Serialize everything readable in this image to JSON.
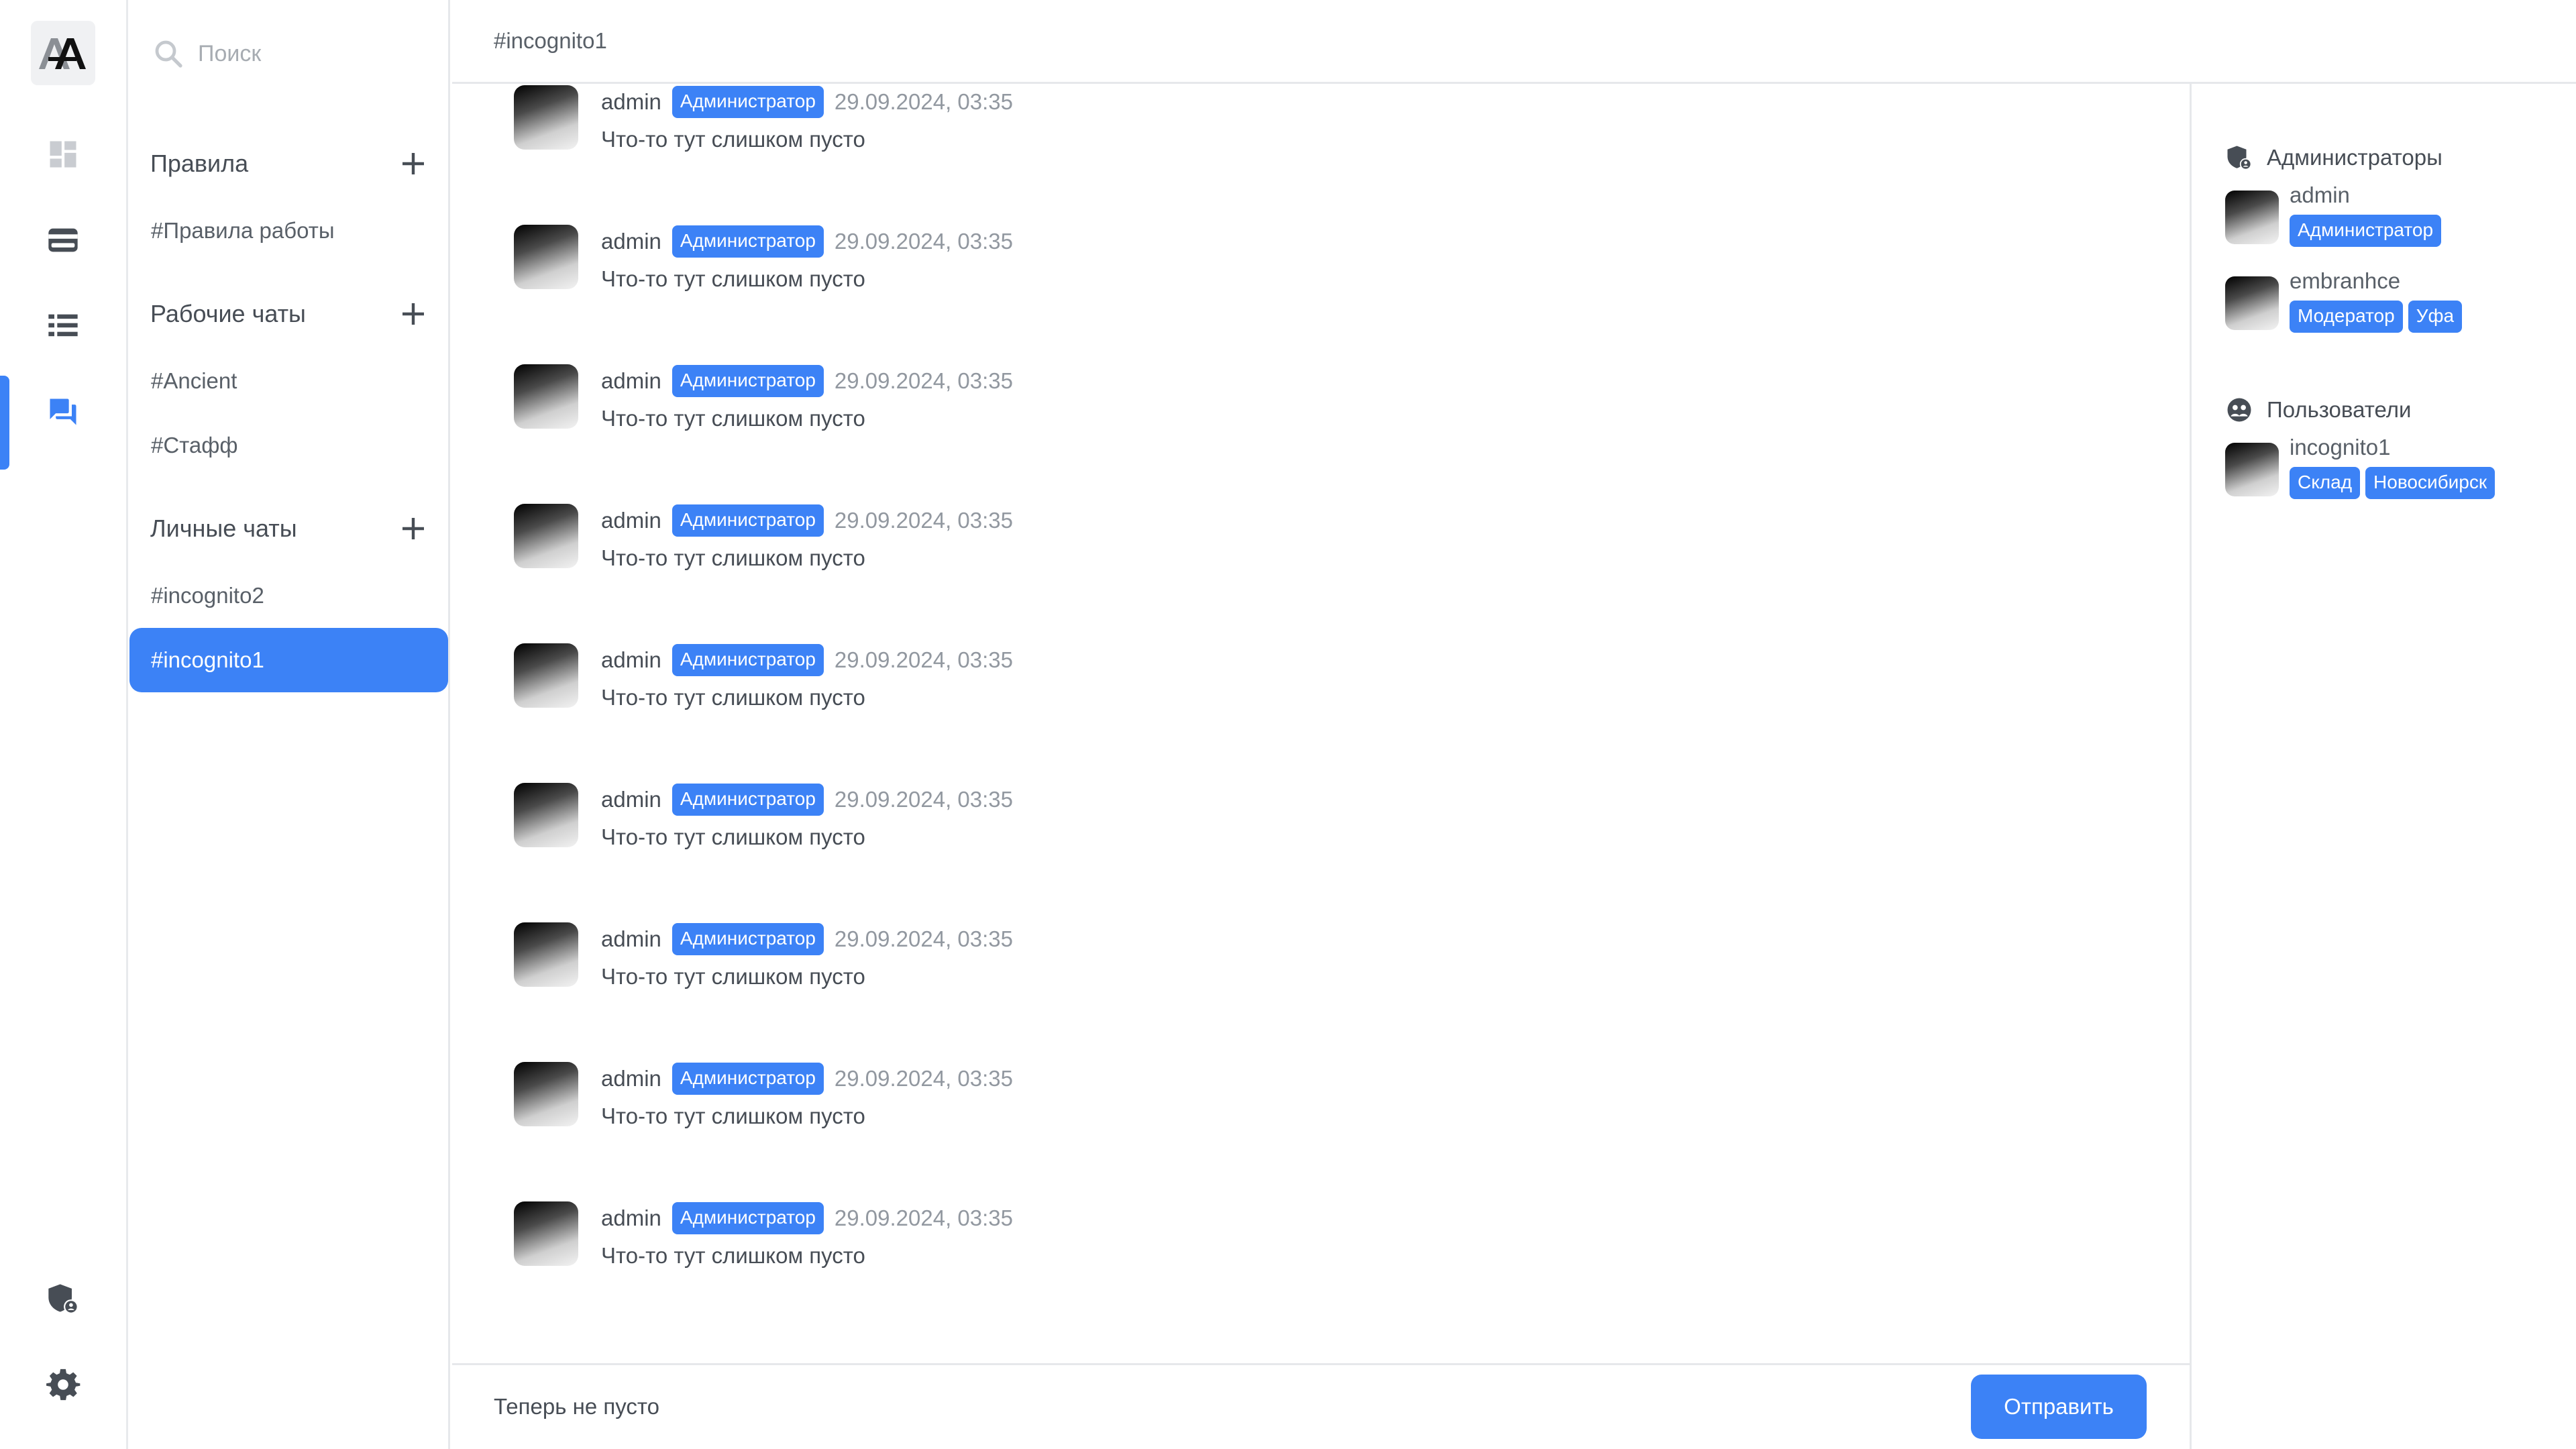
{
  "colors": {
    "accent": "#3c82f6",
    "text": "#474d55",
    "muted": "#9298a0"
  },
  "rail": {
    "logo": "AA",
    "items": [
      {
        "name": "dashboard-icon",
        "active": false
      },
      {
        "name": "wallet-icon",
        "active": false
      },
      {
        "name": "list-icon",
        "active": false
      },
      {
        "name": "chat-icon",
        "active": true
      }
    ],
    "bottom": [
      {
        "name": "admin-shield-icon"
      },
      {
        "name": "gear-icon"
      }
    ]
  },
  "sidebar": {
    "search_placeholder": "Поиск",
    "groups": [
      {
        "title": "Правила",
        "channels": [
          "#Правила работы"
        ]
      },
      {
        "title": "Рабочие чаты",
        "channels": [
          "#Ancient",
          "#Стафф"
        ]
      },
      {
        "title": "Личные чаты",
        "channels": [
          "#incognito2",
          "#incognito1"
        ]
      }
    ],
    "active_channel": "#incognito1"
  },
  "main": {
    "channel_title": "#incognito1",
    "messages": [
      {
        "author": "admin",
        "role": "Администратор",
        "time": "29.09.2024, 03:35",
        "text": "Что-то тут слишком пусто"
      },
      {
        "author": "admin",
        "role": "Администратор",
        "time": "29.09.2024, 03:35",
        "text": "Что-то тут слишком пусто"
      },
      {
        "author": "admin",
        "role": "Администратор",
        "time": "29.09.2024, 03:35",
        "text": "Что-то тут слишком пусто"
      },
      {
        "author": "admin",
        "role": "Администратор",
        "time": "29.09.2024, 03:35",
        "text": "Что-то тут слишком пусто"
      },
      {
        "author": "admin",
        "role": "Администратор",
        "time": "29.09.2024, 03:35",
        "text": "Что-то тут слишком пусто"
      },
      {
        "author": "admin",
        "role": "Администратор",
        "time": "29.09.2024, 03:35",
        "text": "Что-то тут слишком пусто"
      },
      {
        "author": "admin",
        "role": "Администратор",
        "time": "29.09.2024, 03:35",
        "text": "Что-то тут слишком пусто"
      },
      {
        "author": "admin",
        "role": "Администратор",
        "time": "29.09.2024, 03:35",
        "text": "Что-то тут слишком пусто"
      },
      {
        "author": "admin",
        "role": "Администратор",
        "time": "29.09.2024, 03:35",
        "text": "Что-то тут слишком пусто"
      }
    ],
    "composer": {
      "value": "Теперь не пусто",
      "send_label": "Отправить"
    }
  },
  "members": {
    "groups": [
      {
        "title": "Администраторы",
        "icon": "admin-shield-icon",
        "people": [
          {
            "name": "admin",
            "tags": [
              "Администратор"
            ]
          },
          {
            "name": "embranhce",
            "tags": [
              "Модератор",
              "Уфа"
            ]
          }
        ]
      },
      {
        "title": "Пользователи",
        "icon": "users-icon",
        "people": [
          {
            "name": "incognito1",
            "tags": [
              "Склад",
              "Новосибирск"
            ]
          }
        ]
      }
    ]
  }
}
